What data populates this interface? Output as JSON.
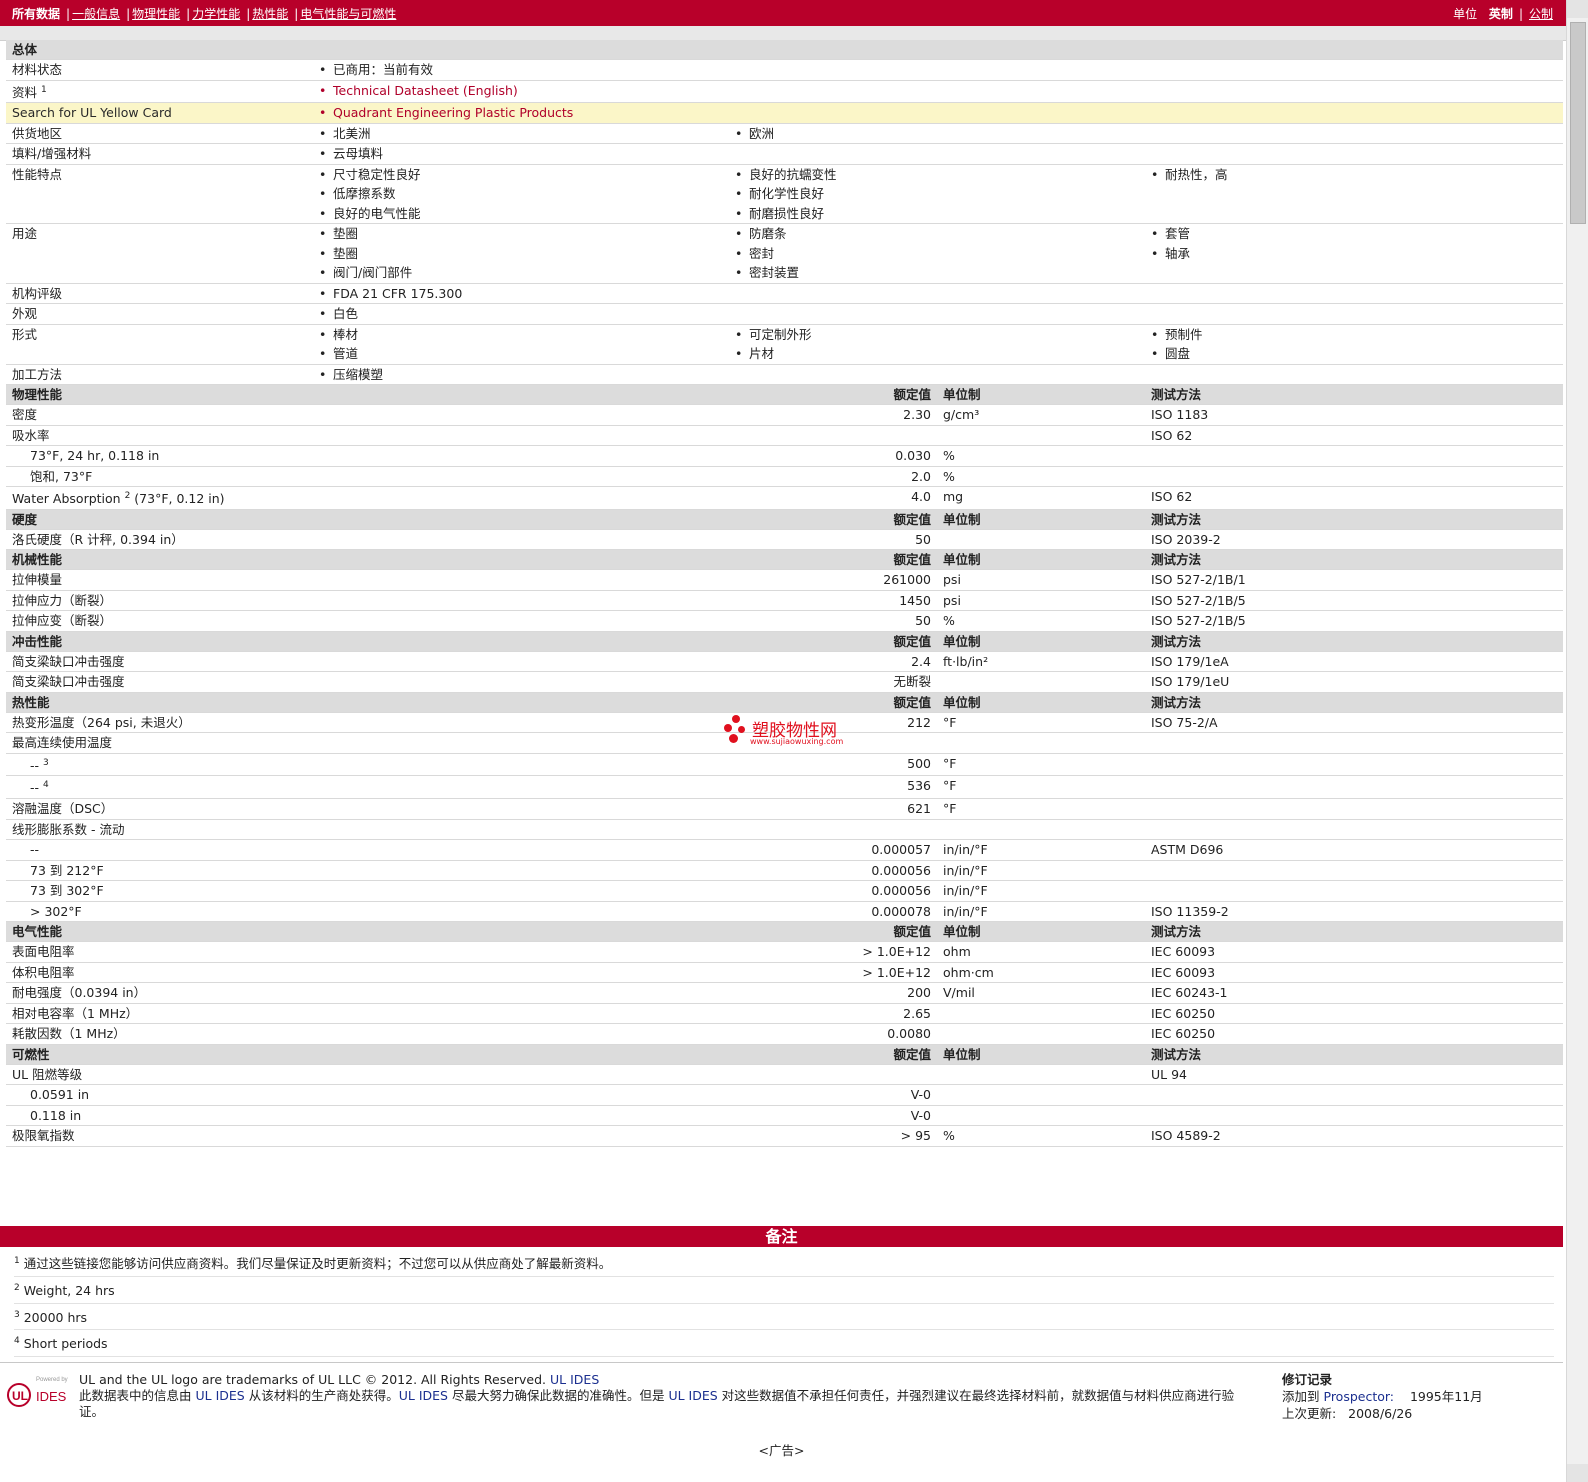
{
  "nav": {
    "items": [
      "所有数据",
      "一般信息",
      "物理性能",
      "力学性能",
      "热性能",
      "电气性能与可燃性"
    ],
    "units_label": "单位",
    "unit_imperial": "英制",
    "unit_metric": "公制"
  },
  "general": {
    "title": "总体",
    "material_status_label": "材料状态",
    "material_status": "已商用：当前有效",
    "resources_label": "资料",
    "resources_sup": "1",
    "resources_link": "Technical Datasheet (English)",
    "ul_label": "Search for UL Yellow Card",
    "ul_link": "Quadrant Engineering Plastic Products",
    "availability_label": "供货地区",
    "availability": [
      "北美洲",
      "欧洲"
    ],
    "filler_label": "填料/增强材料",
    "filler": "云母填料",
    "features_label": "性能特点",
    "features": [
      "尺寸稳定性良好",
      "良好的抗蠕变性",
      "耐热性，高",
      "低摩擦系数",
      "耐化学性良好",
      "良好的电气性能",
      "耐磨损性良好"
    ],
    "uses_label": "用途",
    "uses": [
      "垫圈",
      "防磨条",
      "套管",
      "垫圈",
      "密封",
      "轴承",
      "阀门/阀门部件",
      "密封装置"
    ],
    "agency_label": "机构评级",
    "agency": "FDA 21 CFR 175.300",
    "appearance_label": "外观",
    "appearance": "白色",
    "forms_label": "形式",
    "forms": [
      "棒材",
      "可定制外形",
      "预制件",
      "管道",
      "片材",
      "圆盘"
    ],
    "processing_label": "加工方法",
    "processing": "压缩模塑"
  },
  "headers": {
    "nominal": "额定值",
    "unit": "单位制",
    "method": "测试方法"
  },
  "physical": {
    "title": "物理性能",
    "rows": [
      {
        "label": "密度",
        "value": "2.30",
        "unit": "g/cm³",
        "method": "ISO 1183"
      },
      {
        "label": "吸水率",
        "value": "",
        "unit": "",
        "method": "ISO 62"
      },
      {
        "label": "73°F, 24 hr, 0.118 in",
        "value": "0.030",
        "unit": "%",
        "method": "",
        "indent": true
      },
      {
        "label": "饱和, 73°F",
        "value": "2.0",
        "unit": "%",
        "method": "",
        "indent": true
      },
      {
        "label": "Water Absorption",
        "sup": "2",
        "label2": " (73°F, 0.12 in)",
        "value": "4.0",
        "unit": "mg",
        "method": "ISO 62"
      }
    ]
  },
  "hardness": {
    "title": "硬度",
    "rows": [
      {
        "label": "洛氏硬度（R 计秤, 0.394 in）",
        "value": "50",
        "unit": "",
        "method": "ISO 2039-2"
      }
    ]
  },
  "mechanical": {
    "title": "机械性能",
    "rows": [
      {
        "label": "拉伸模量",
        "value": "261000",
        "unit": "psi",
        "method": "ISO 527-2/1B/1"
      },
      {
        "label": "拉伸应力（断裂）",
        "value": "1450",
        "unit": "psi",
        "method": "ISO 527-2/1B/5"
      },
      {
        "label": "拉伸应变（断裂）",
        "value": "50",
        "unit": "%",
        "method": "ISO 527-2/1B/5"
      }
    ]
  },
  "impact": {
    "title": "冲击性能",
    "rows": [
      {
        "label": "简支梁缺口冲击强度",
        "value": "2.4",
        "unit": "ft·lb/in²",
        "method": "ISO 179/1eA"
      },
      {
        "label": "简支梁缺口冲击强度",
        "value": "无断裂",
        "unit": "",
        "method": "ISO 179/1eU"
      }
    ]
  },
  "thermal": {
    "title": "热性能",
    "rows": [
      {
        "label": "热变形温度（264 psi, 未退火）",
        "value": "212",
        "unit": "°F",
        "method": "ISO 75-2/A"
      },
      {
        "label": "最高连续使用温度",
        "value": "",
        "unit": "",
        "method": ""
      },
      {
        "label": "--",
        "sup": "3",
        "value": "500",
        "unit": "°F",
        "method": "",
        "indent": true
      },
      {
        "label": "--",
        "sup": "4",
        "value": "536",
        "unit": "°F",
        "method": "",
        "indent": true
      },
      {
        "label": "溶融温度（DSC）",
        "value": "621",
        "unit": "°F",
        "method": ""
      },
      {
        "label": "线形膨胀系数 - 流动",
        "value": "",
        "unit": "",
        "method": ""
      },
      {
        "label": "--",
        "value": "0.000057",
        "unit": "in/in/°F",
        "method": "ASTM D696",
        "indent": true
      },
      {
        "label": "73 到 212°F",
        "value": "0.000056",
        "unit": "in/in/°F",
        "method": "",
        "indent": true
      },
      {
        "label": "73 到 302°F",
        "value": "0.000056",
        "unit": "in/in/°F",
        "method": "",
        "indent": true
      },
      {
        "label": "> 302°F",
        "value": "0.000078",
        "unit": "in/in/°F",
        "method": "ISO 11359-2",
        "indent": true
      }
    ]
  },
  "electrical": {
    "title": "电气性能",
    "rows": [
      {
        "label": "表面电阻率",
        "value": "> 1.0E+12",
        "unit": "ohm",
        "method": "IEC 60093"
      },
      {
        "label": "体积电阻率",
        "value": "> 1.0E+12",
        "unit": "ohm·cm",
        "method": "IEC 60093"
      },
      {
        "label": "耐电强度（0.0394 in）",
        "value": "200",
        "unit": "V/mil",
        "method": "IEC 60243-1"
      },
      {
        "label": "相对电容率（1 MHz）",
        "value": "2.65",
        "unit": "",
        "method": "IEC 60250"
      },
      {
        "label": "耗散因数（1 MHz）",
        "value": "0.0080",
        "unit": "",
        "method": "IEC 60250"
      }
    ]
  },
  "flammability": {
    "title": "可燃性",
    "rows": [
      {
        "label": "UL 阻燃等级",
        "value": "",
        "unit": "",
        "method": "UL 94"
      },
      {
        "label": "0.0591 in",
        "value": "V-0",
        "unit": "",
        "method": "",
        "indent": true
      },
      {
        "label": "0.118 in",
        "value": "V-0",
        "unit": "",
        "method": "",
        "indent": true
      },
      {
        "label": "极限氧指数",
        "value": "> 95",
        "unit": "%",
        "method": "ISO 4589-2"
      }
    ]
  },
  "notes": {
    "title": "备注",
    "items": [
      {
        "n": "1",
        "text": "通过这些链接您能够访问供应商资料。我们尽量保证及时更新资料；不过您可以从供应商处了解最新资料。"
      },
      {
        "n": "2",
        "text": "Weight, 24 hrs"
      },
      {
        "n": "3",
        "text": "20000 hrs"
      },
      {
        "n": "4",
        "text": "Short periods"
      }
    ]
  },
  "footer": {
    "logo_small": "Powered by",
    "logo_text": "IDES",
    "line1": "UL and the UL logo are trademarks of UL LLC © 2012. All Rights Reserved.",
    "line1_link": "UL IDES",
    "line2a": "此数据表中的信息由",
    "line2_link1": "UL IDES",
    "line2b": "从该材料的生产商处获得。",
    "line2_link2": "UL IDES",
    "line2c": "尽最大努力确保此数据的准确性。但是",
    "line2_link3": "UL IDES",
    "line2d": "对这些数据值不承担任何责任，并强烈建议在最终选择材料前，就数据值与材料供应商进行验证。",
    "rev_title": "修订记录",
    "added_label": "添加到",
    "added_link": "Prospector:",
    "added_date": "1995年11月",
    "updated_label": "上次更新:",
    "updated_date": "2008/6/26",
    "ad": "<广告>"
  },
  "watermark": {
    "name": "塑胶物性网",
    "url": "www.sujiaowuxing.com"
  },
  "colors": {
    "brand_red": "#b8002a",
    "link_red": "#b0002a",
    "section_gray": "#dcdcdc",
    "highlight": "#fbf6c8"
  }
}
